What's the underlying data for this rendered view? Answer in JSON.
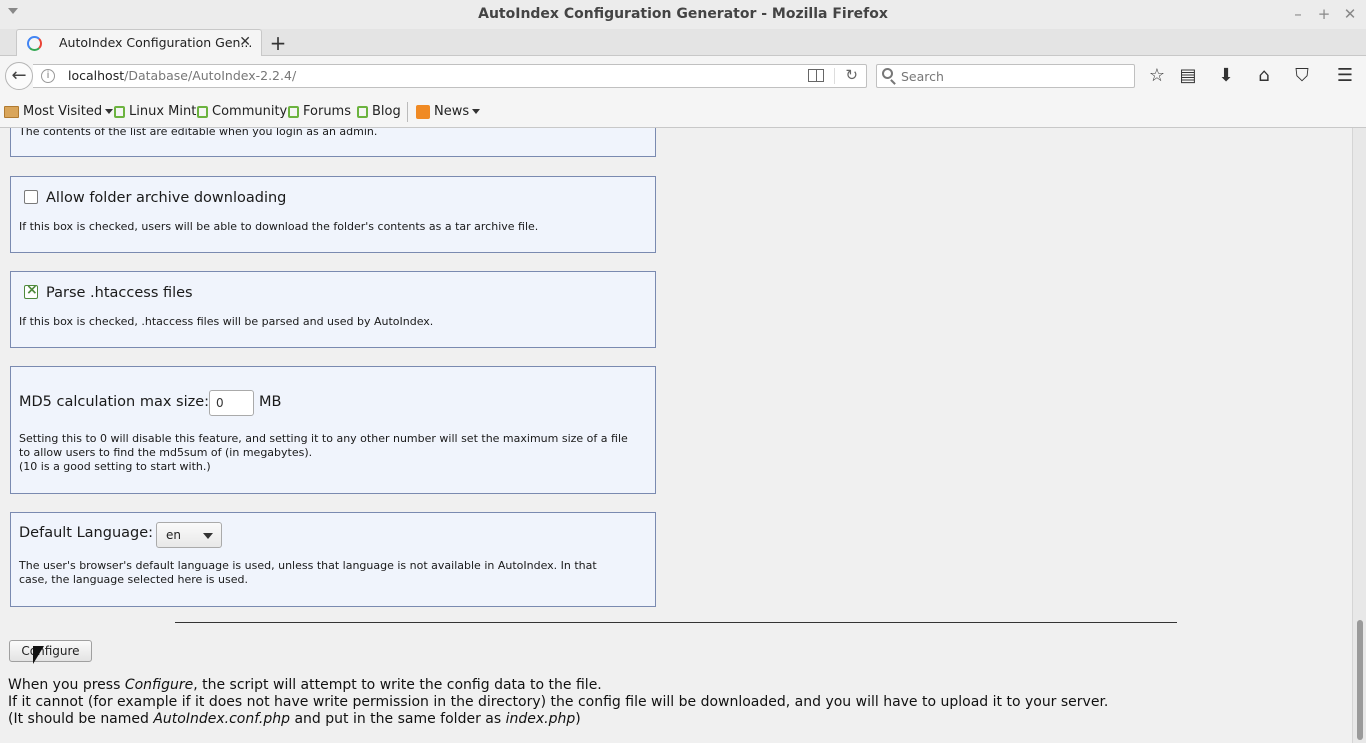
{
  "window": {
    "title": "AutoIndex Configuration Generator - Mozilla Firefox",
    "controls": {
      "minimize": "–",
      "maximize": "+",
      "close": "✕"
    }
  },
  "tab": {
    "title": "AutoIndex Configuration Gen...",
    "close": "✕",
    "new_tab": "+"
  },
  "nav": {
    "url_host": "localhost",
    "url_path": "/Database/AutoIndex-2.2.4/",
    "search_placeholder": "Search",
    "icons": [
      "back-icon",
      "info-icon",
      "reader-view-icon",
      "reload-icon",
      "search-icon",
      "bookmark-star-icon",
      "library-icon",
      "download-icon",
      "home-icon",
      "pocket-icon",
      "hamburger-menu-icon"
    ]
  },
  "bookmarks": {
    "most_visited": "Most Visited",
    "linux_mint": "Linux Mint",
    "community": "Community",
    "forums": "Forums",
    "blog": "Blog",
    "news": "News"
  },
  "form": {
    "partial_text": "The contents of the list are editable when you login as an admin.",
    "archive": {
      "label": "Allow folder archive downloading",
      "checked": false,
      "desc": "If this box is checked, users will be able to download the folder's contents as a tar archive file."
    },
    "htaccess": {
      "label": "Parse .htaccess files",
      "checked": true,
      "desc": "If this box is checked, .htaccess files will be parsed and used by AutoIndex."
    },
    "md5": {
      "label": "MD5 calculation max size:",
      "value": "0",
      "unit": "MB",
      "desc_1": "Setting this to 0 will disable this feature, and setting it to any other number will set the maximum size of a file",
      "desc_2": "to allow users to find the md5sum of (in megabytes).",
      "desc_3": "(10 is a good setting to start with.)"
    },
    "language": {
      "label": "Default Language:",
      "selected": "en",
      "desc_1": "The user's browser's default language is used, unless that language is not available in AutoIndex. In that",
      "desc_2": "case, the language selected here is used."
    },
    "configure_button": "Configure",
    "notes": {
      "line1_a": "When you press ",
      "line1_em": "Configure",
      "line1_b": ", the script will attempt to write the config data to the file.",
      "line2": "If it cannot (for example if it does not have write permission in the directory) the config file will be downloaded, and you will have to upload it to your server.",
      "line3_a": "(It should be named ",
      "line3_em1": "AutoIndex.conf.php",
      "line3_b": " and put in the same folder as ",
      "line3_em2": "index.php",
      "line3_c": ")"
    }
  }
}
